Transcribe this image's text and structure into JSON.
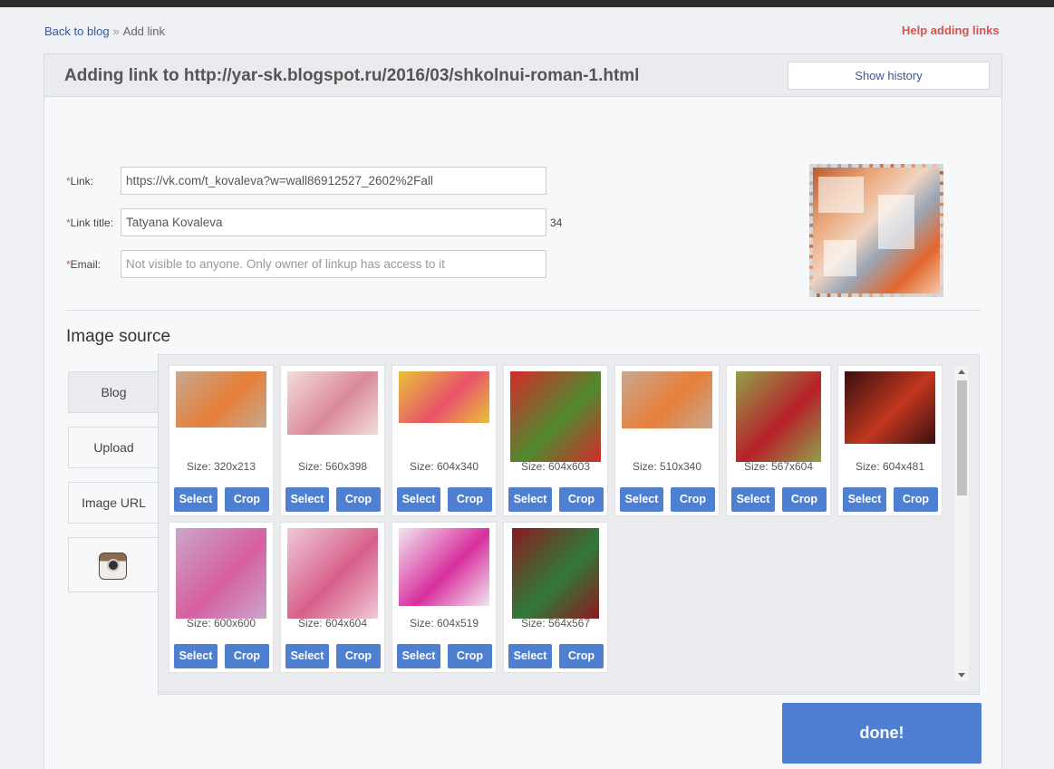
{
  "breadcrumb": {
    "back": "Back to blog",
    "sep": "»",
    "current": "Add link"
  },
  "help": "Help adding links",
  "panel": {
    "title": "Adding link to http://yar-sk.blogspot.ru/2016/03/shkolnui-roman-1.html",
    "show_history": "Show history"
  },
  "form": {
    "link_label": "Link:",
    "link_value": "https://vk.com/t_kovaleva?w=wall86912527_2602%2Fall",
    "title_label": "Link title:",
    "title_value": "Tatyana Kovaleva",
    "title_count": "34",
    "email_label": "Email:",
    "email_placeholder": "Not visible to anyone. Only owner of linkup has access to it",
    "required": "*"
  },
  "image_source": {
    "title": "Image source",
    "tabs": [
      "Blog",
      "Upload",
      "Image URL"
    ]
  },
  "images": [
    {
      "size": "Size: 320x213",
      "colors": [
        "#c7a98f",
        "#e67e3a"
      ]
    },
    {
      "size": "Size: 560x398",
      "colors": [
        "#f2dcd8",
        "#d98a9a"
      ]
    },
    {
      "size": "Size: 604x340",
      "colors": [
        "#e8c23a",
        "#e8526a"
      ]
    },
    {
      "size": "Size: 604x603",
      "colors": [
        "#d52a2a",
        "#4f8a2f"
      ]
    },
    {
      "size": "Size: 510x340",
      "colors": [
        "#c7a98f",
        "#e67e3a"
      ]
    },
    {
      "size": "Size: 567x604",
      "colors": [
        "#8fa04a",
        "#b8202a"
      ]
    },
    {
      "size": "Size: 604x481",
      "colors": [
        "#3a1010",
        "#c2361f"
      ]
    },
    {
      "size": "Size: 600x600",
      "colors": [
        "#caa6c9",
        "#d65fa0"
      ]
    },
    {
      "size": "Size: 604x604",
      "colors": [
        "#f0c8d8",
        "#d65f8a"
      ]
    },
    {
      "size": "Size: 604x519",
      "colors": [
        "#f0e6ee",
        "#d82f9f"
      ]
    },
    {
      "size": "Size: 564x567",
      "colors": [
        "#8a1a1f",
        "#2f7a3a"
      ]
    }
  ],
  "buttons": {
    "select": "Select",
    "crop": "Crop",
    "done": "done!"
  }
}
